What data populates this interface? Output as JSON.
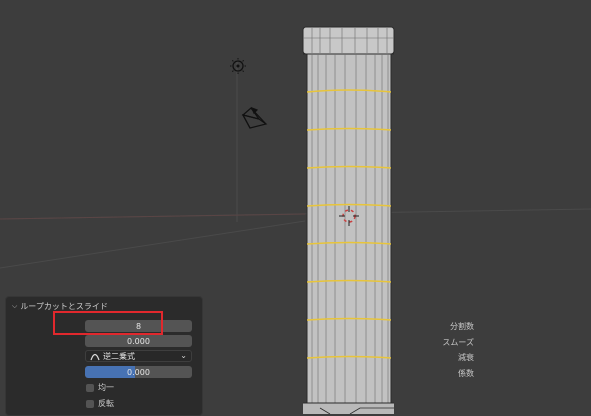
{
  "operator_panel": {
    "title": "ループカットとスライド",
    "cuts": {
      "label": "分割数",
      "value": "8"
    },
    "smoothness": {
      "label": "スムーズ",
      "value": "0.000"
    },
    "falloff": {
      "label": "減衰",
      "value": "逆二乗式"
    },
    "factor": {
      "label": "係数",
      "value": "0.000",
      "fill_fraction": 0.47
    },
    "even": {
      "label": "均一"
    },
    "flipped": {
      "label": "反転"
    }
  },
  "colors": {
    "viewport_bg": "#3d3d3d",
    "mesh_face": "#c2c2c2",
    "loop_edges": "#e8c53a",
    "highlight_box": "#e1282d",
    "slider_fill": "#4772b3"
  },
  "icons": [
    "light-icon",
    "camera-icon",
    "cursor-3d-icon",
    "chevron-down-icon",
    "falloff-curve-icon"
  ]
}
